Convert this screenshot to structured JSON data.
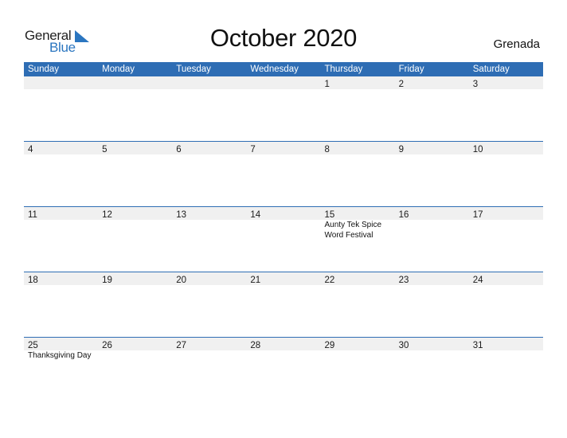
{
  "logo": {
    "general": "General",
    "blue": "Blue",
    "icon": "blue-triangle-icon"
  },
  "title": "October 2020",
  "country": "Grenada",
  "colors": {
    "header_bg": "#2e6db4",
    "date_strip_bg": "#f0f0f0",
    "brand_blue": "#2b76c0"
  },
  "weekdays": [
    "Sunday",
    "Monday",
    "Tuesday",
    "Wednesday",
    "Thursday",
    "Friday",
    "Saturday"
  ],
  "weeks": [
    {
      "days": [
        "",
        "",
        "",
        "",
        "1",
        "2",
        "3"
      ],
      "events": [
        "",
        "",
        "",
        "",
        "",
        "",
        ""
      ]
    },
    {
      "days": [
        "4",
        "5",
        "6",
        "7",
        "8",
        "9",
        "10"
      ],
      "events": [
        "",
        "",
        "",
        "",
        "",
        "",
        ""
      ]
    },
    {
      "days": [
        "11",
        "12",
        "13",
        "14",
        "15",
        "16",
        "17"
      ],
      "events": [
        "",
        "",
        "",
        "",
        "Aunty Tek Spice Word Festival",
        "",
        ""
      ]
    },
    {
      "days": [
        "18",
        "19",
        "20",
        "21",
        "22",
        "23",
        "24"
      ],
      "events": [
        "",
        "",
        "",
        "",
        "",
        "",
        ""
      ]
    },
    {
      "days": [
        "25",
        "26",
        "27",
        "28",
        "29",
        "30",
        "31"
      ],
      "events": [
        "Thanksgiving Day",
        "",
        "",
        "",
        "",
        "",
        ""
      ]
    }
  ]
}
